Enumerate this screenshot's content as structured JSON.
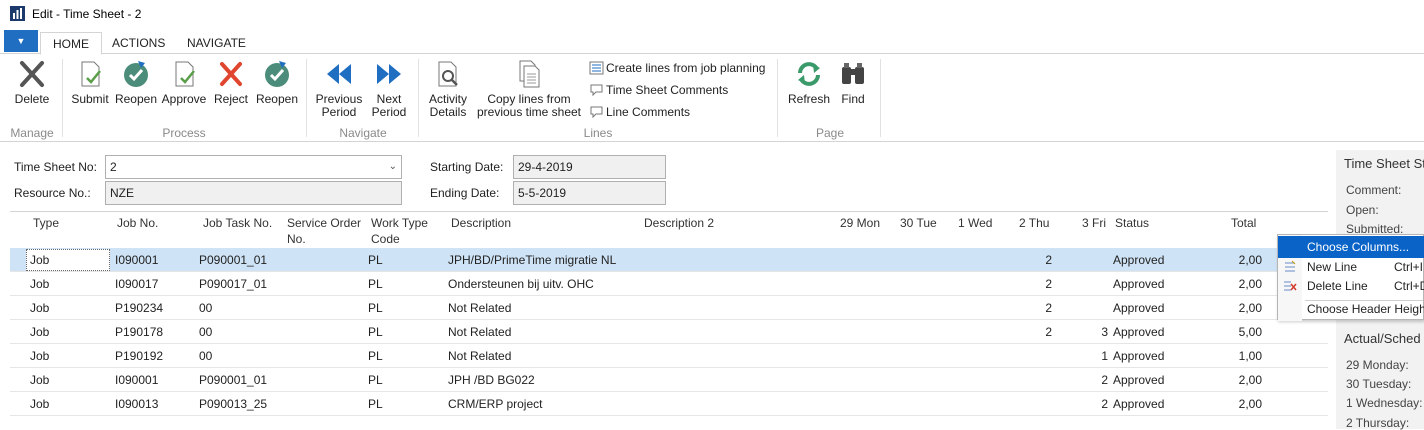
{
  "window": {
    "title": "Edit - Time Sheet - 2"
  },
  "tabs": {
    "home": "HOME",
    "actions": "ACTIONS",
    "navigate": "NAVIGATE",
    "app_menu": "▼"
  },
  "ribbon": {
    "delete": "Delete",
    "submit": "Submit",
    "reopen1": "Reopen",
    "approve": "Approve",
    "reject": "Reject",
    "reopen2": "Reopen",
    "prev1": "Previous",
    "prev2": "Period",
    "next1": "Next",
    "next2": "Period",
    "act1": "Activity",
    "act2": "Details",
    "copy1": "Copy lines from",
    "copy2": "previous time sheet",
    "create_lines": "Create lines from job planning",
    "ts_comments": "Time Sheet Comments",
    "line_comments": "Line Comments",
    "refresh": "Refresh",
    "find": "Find",
    "groups": {
      "manage": "Manage",
      "process": "Process",
      "navigate": "Navigate",
      "lines": "Lines",
      "page": "Page"
    }
  },
  "header": {
    "ts_no_label": "Time Sheet No:",
    "ts_no_value": "2",
    "resource_label": "Resource No.:",
    "resource_value": "NZE",
    "start_label": "Starting Date:",
    "start_value": "29-4-2019",
    "end_label": "Ending Date:",
    "end_value": "5-5-2019"
  },
  "grid": {
    "columns": {
      "type": "Type",
      "job_no": "Job No.",
      "job_task": "Job Task No.",
      "service1": "Service Order",
      "service2": "No.",
      "work1": "Work Type",
      "work2": "Code",
      "description": "Description",
      "description2": "Description 2",
      "d29": "29 Mon",
      "d30": "30 Tue",
      "d1": "1 Wed",
      "d2": "2 Thu",
      "d3": "3 Fri",
      "status": "Status",
      "total": "Total"
    },
    "rows": [
      {
        "type": "Job",
        "job_no": "I090001",
        "job_task": "P090001_01",
        "work": "PL",
        "desc": "JPH/BD/PrimeTime migratie NL",
        "thu": "2",
        "fri": "",
        "status": "Approved",
        "total": "2,00"
      },
      {
        "type": "Job",
        "job_no": "I090017",
        "job_task": "P090017_01",
        "work": "PL",
        "desc": "Ondersteunen bij uitv. OHC",
        "thu": "2",
        "fri": "",
        "status": "Approved",
        "total": "2,00"
      },
      {
        "type": "Job",
        "job_no": "P190234",
        "job_task": "00",
        "work": "PL",
        "desc": "Not Related",
        "thu": "2",
        "fri": "",
        "status": "Approved",
        "total": "2,00"
      },
      {
        "type": "Job",
        "job_no": "P190178",
        "job_task": "00",
        "work": "PL",
        "desc": "Not Related",
        "thu": "2",
        "fri": "3",
        "status": "Approved",
        "total": "5,00"
      },
      {
        "type": "Job",
        "job_no": "P190192",
        "job_task": "00",
        "work": "PL",
        "desc": "Not Related",
        "thu": "",
        "fri": "1",
        "status": "Approved",
        "total": "1,00"
      },
      {
        "type": "Job",
        "job_no": "I090001",
        "job_task": "P090001_01",
        "work": "PL",
        "desc": "JPH /BD BG022",
        "thu": "",
        "fri": "2",
        "status": "Approved",
        "total": "2,00"
      },
      {
        "type": "Job",
        "job_no": "I090013",
        "job_task": "P090013_25",
        "work": "PL",
        "desc": "CRM/ERP project",
        "thu": "",
        "fri": "2",
        "status": "Approved",
        "total": "2,00"
      }
    ]
  },
  "context_menu": {
    "choose": "Choose Columns...",
    "new": "New Line",
    "new_key": "Ctrl+I",
    "delete": "Delete Line",
    "delete_key": "Ctrl+D",
    "header": "Choose Header Heigh"
  },
  "right_panel": {
    "title": "Time Sheet St",
    "comment": "Comment:",
    "open": "Open:",
    "submitted": "Submitted:",
    "actual_title": "Actual/Sched",
    "mon": "29 Monday:",
    "tue": "30 Tuesday:",
    "wed": "1 Wednesday:",
    "thu": "2 Thursday:"
  },
  "colors": {
    "accent": "#1f6ec2",
    "selection": "#cfe3f6",
    "menu_highlight": "#0a64c8"
  }
}
